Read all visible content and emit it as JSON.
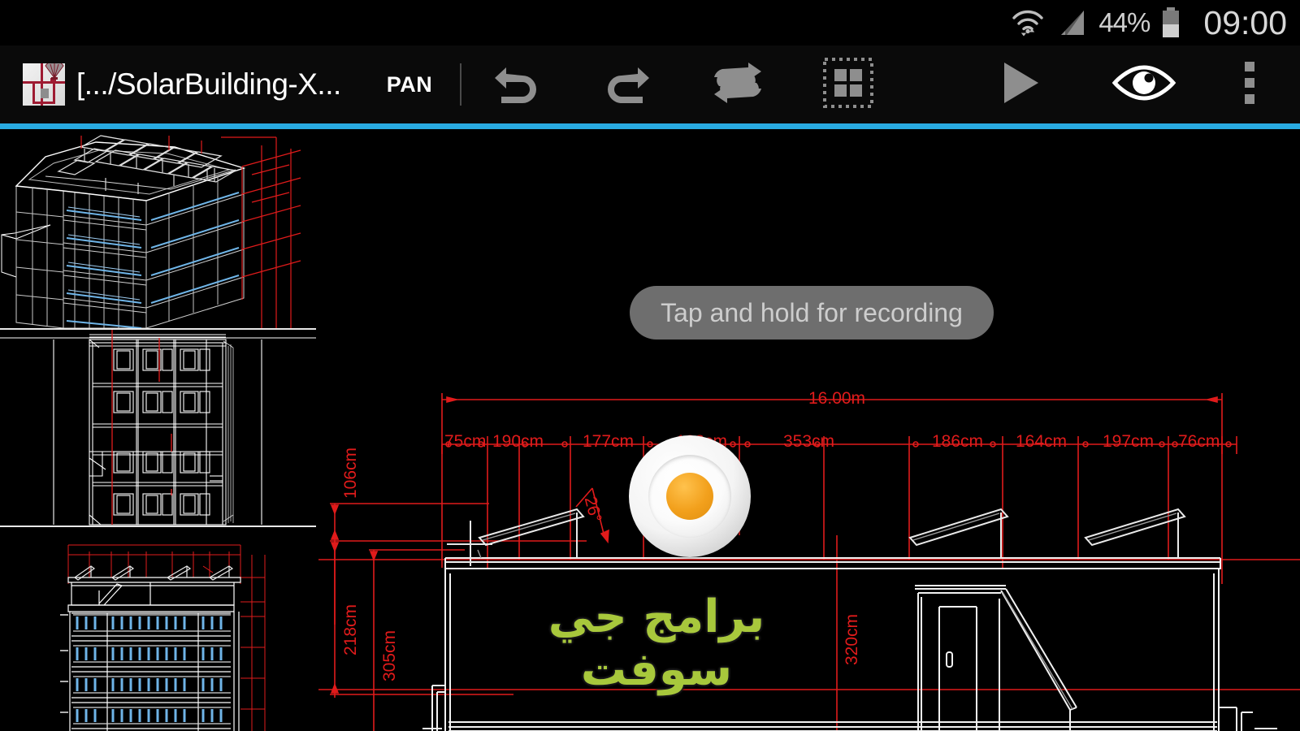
{
  "status_bar": {
    "wifi_icon": "wifi-updown-icon",
    "signal_icon": "cellular-signal-icon",
    "battery_percent": "44%",
    "battery_icon": "battery-icon",
    "clock": "09:00"
  },
  "toolbar": {
    "app_icon": "cad-app-icon",
    "file_title": "[.../SolarBuilding-X...",
    "mode_label": "PAN",
    "buttons": [
      {
        "name": "undo-button",
        "icon": "undo-arrow-icon",
        "label": "Undo"
      },
      {
        "name": "redo-button",
        "icon": "redo-arrow-icon",
        "label": "Redo"
      },
      {
        "name": "regen-button",
        "icon": "loop-arrows-icon",
        "label": "Regenerate"
      },
      {
        "name": "layers-button",
        "icon": "grid-select-icon",
        "label": "Layers"
      },
      {
        "name": "play-button",
        "icon": "play-triangle-icon",
        "label": "Play"
      },
      {
        "name": "visibility-button",
        "icon": "eye-icon",
        "label": "View"
      },
      {
        "name": "overflow-menu-button",
        "icon": "three-dots-vertical-icon",
        "label": "More options"
      }
    ]
  },
  "canvas": {
    "record_hint": "Tap and hold for recording",
    "record_button_icon": "record-circle-icon",
    "watermark_text": "برامج جي سوفت",
    "cursor_icon": "crosshair-cursor-icon"
  },
  "sidebar": {
    "thumbnails": [
      {
        "name": "thumbnail-3d-isometric",
        "label": "3D Isometric Solar Building"
      },
      {
        "name": "thumbnail-floor-plan",
        "label": "Structural Grid Plan"
      },
      {
        "name": "thumbnail-elevation",
        "label": "Building Elevation"
      }
    ]
  },
  "drawing": {
    "overall_dimension": "16.00m",
    "horizontal_chain": [
      "75cm",
      "190cm",
      "177cm",
      "182cm",
      "353cm",
      "186cm",
      "164cm",
      "197cm",
      "76cm"
    ],
    "vertical_chain": [
      "106cm",
      "218cm",
      "305cm"
    ],
    "secondary_vertical": "320cm",
    "angle_label": "26°"
  },
  "colors": {
    "accent_cyan": "#29abe2",
    "dimension_red": "#e01b1b",
    "watermark_green": "#a8c83c",
    "record_orange": "#f2a01c",
    "toolbar_icon_gray": "#8e8e8e",
    "window_blue": "#6fb5e8",
    "drawing_white": "#e8e8e8"
  }
}
